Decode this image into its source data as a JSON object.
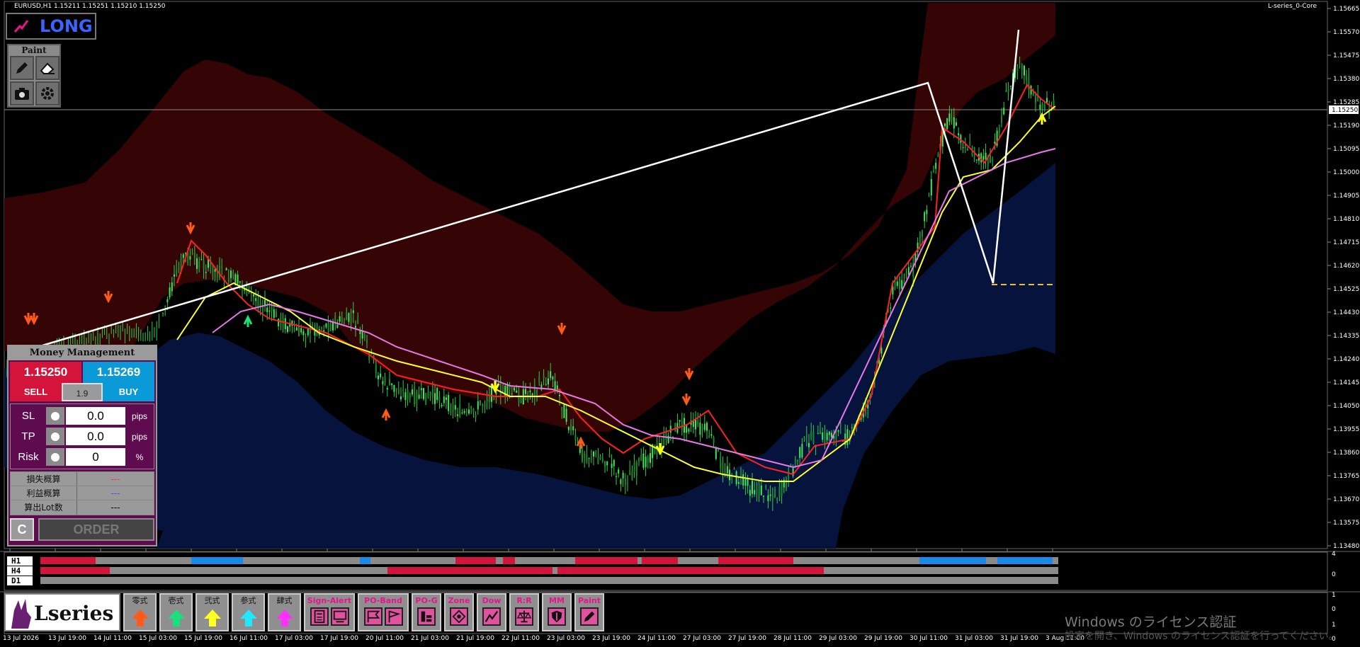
{
  "symbol_info": "EURUSD,H1  1.15211 1.15251 1.15210 1.15250",
  "indicator_name": "L-series_0-Core",
  "signal_label": "LONG",
  "current_price": "1.15250",
  "price_axis": [
    "1.15665",
    "1.15570",
    "1.15475",
    "1.15380",
    "1.15285",
    "1.15190",
    "1.15095",
    "1.15000",
    "1.14905",
    "1.14810",
    "1.14715",
    "1.14620",
    "1.14525",
    "1.14430",
    "1.14335",
    "1.14240",
    "1.14145",
    "1.14050",
    "1.13955",
    "1.13860",
    "1.13765",
    "1.13670",
    "1.13575",
    "1.13480"
  ],
  "time_axis": [
    "13 Jul 2026",
    "13 Jul 19:00",
    "14 Jul 11:00",
    "15 Jul 03:00",
    "15 Jul 19:00",
    "16 Jul 11:00",
    "17 Jul 03:00",
    "17 Jul 19:00",
    "20 Jul 11:00",
    "21 Jul 03:00",
    "21 Jul 19:00",
    "22 Jul 11:00",
    "23 Jul 03:00",
    "23 Jul 19:00",
    "24 Jul 11:00",
    "27 Jul 03:00",
    "27 Jul 19:00",
    "28 Jul 11:00",
    "29 Jul 03:00",
    "29 Jul 19:00",
    "30 Jul 11:00",
    "31 Jul 03:00",
    "31 Jul 19:00",
    "3 Aug 11:00"
  ],
  "paint_panel": {
    "title": "Paint",
    "buttons": [
      "pencil-icon",
      "eraser-icon",
      "camera-icon",
      "gear-icon"
    ]
  },
  "money_management": {
    "title": "Money Management",
    "bid": "1.15250",
    "ask": "1.15269",
    "sell_label": "SELL",
    "lot": "1.9",
    "buy_label": "BUY",
    "rows": [
      {
        "label": "SL",
        "value": "0.0",
        "unit": "pips"
      },
      {
        "label": "TP",
        "value": "0.0",
        "unit": "pips"
      },
      {
        "label": "Risk",
        "value": "0",
        "unit": "%"
      }
    ],
    "calc": [
      {
        "label": "損失概算",
        "value": "---",
        "color": "#ff3030"
      },
      {
        "label": "利益概算",
        "value": "---",
        "color": "#3050ff"
      },
      {
        "label": "算出Lot数",
        "value": "---",
        "color": "#000000"
      }
    ],
    "clear_label": "C",
    "order_label": "ORDER"
  },
  "timeframes": {
    "labels": [
      "H1",
      "H4",
      "D1"
    ],
    "sub_axis": [
      "4",
      "0",
      "1",
      "0",
      "1",
      "0"
    ]
  },
  "toolbar": {
    "logo_text": "Lseries",
    "arrow_buttons": [
      {
        "label": "零式",
        "color": "#ff5a1a"
      },
      {
        "label": "壱式",
        "color": "#19e07a"
      },
      {
        "label": "弐式",
        "color": "#ffff20"
      },
      {
        "label": "参式",
        "color": "#20e8ff"
      },
      {
        "label": "肆式",
        "color": "#ff30ff"
      }
    ],
    "panel_buttons": [
      {
        "label": "Sign-Alert",
        "icons": [
          "calculator-icon",
          "monitor-icon"
        ]
      },
      {
        "label": "PO-Band",
        "icons": [
          "flag-icon",
          "flag-alt-icon"
        ]
      },
      {
        "label": "PO-G",
        "icons": [
          "chart-g-icon"
        ]
      },
      {
        "label": "Zone",
        "icons": [
          "diamond-icon"
        ]
      },
      {
        "label": "Dow",
        "icons": [
          "zigzag-icon"
        ]
      },
      {
        "label": "R:R",
        "icons": [
          "scale-icon"
        ]
      },
      {
        "label": "MM",
        "icons": [
          "shield-icon"
        ]
      },
      {
        "label": "Paint",
        "icons": [
          "pencil-icon"
        ]
      }
    ]
  },
  "watermark": {
    "title": "Windows のライセンス認証",
    "sub": "設定を開き、Windows のライセンス認証を行ってください。"
  }
}
